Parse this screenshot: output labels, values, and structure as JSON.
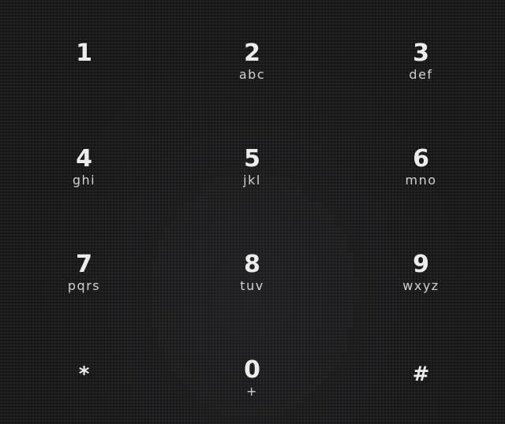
{
  "dialpad": {
    "keys": [
      {
        "digit": "1",
        "letters": ""
      },
      {
        "digit": "2",
        "letters": "abc"
      },
      {
        "digit": "3",
        "letters": "def"
      },
      {
        "digit": "4",
        "letters": "ghi"
      },
      {
        "digit": "5",
        "letters": "jkl"
      },
      {
        "digit": "6",
        "letters": "mno"
      },
      {
        "digit": "7",
        "letters": "pqrs"
      },
      {
        "digit": "8",
        "letters": "tuv"
      },
      {
        "digit": "9",
        "letters": "wxyz"
      },
      {
        "digit": "*",
        "letters": ""
      },
      {
        "digit": "0",
        "letters": "+"
      },
      {
        "digit": "#",
        "letters": ""
      }
    ]
  }
}
